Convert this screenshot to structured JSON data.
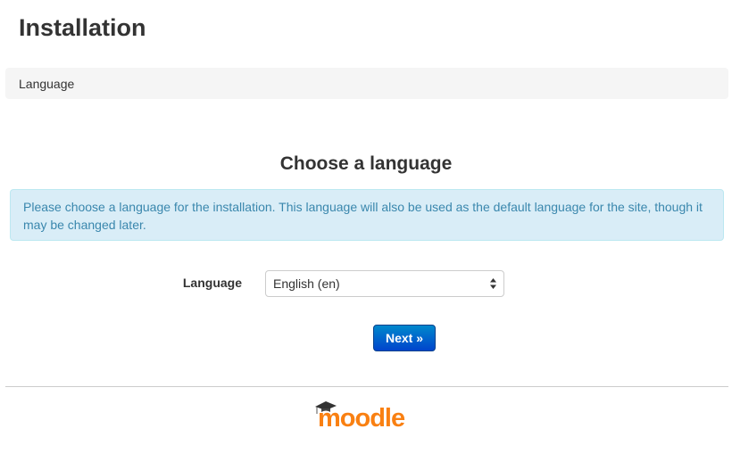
{
  "page": {
    "title": "Installation"
  },
  "breadcrumb": {
    "label": "Language"
  },
  "main": {
    "heading": "Choose a language",
    "info_text": "Please choose a language for the installation. This language will also be used as the default language for the site, though it may be changed later."
  },
  "form": {
    "language_label": "Language",
    "language_selected": "English (en)",
    "next_label": "Next »"
  },
  "footer": {
    "logo_text": "moodle"
  },
  "colors": {
    "accent_button": "#0055cc",
    "info_background": "#d9edf7",
    "info_text": "#3a87ad",
    "logo_orange": "#f98012",
    "logo_dark": "#333333"
  }
}
